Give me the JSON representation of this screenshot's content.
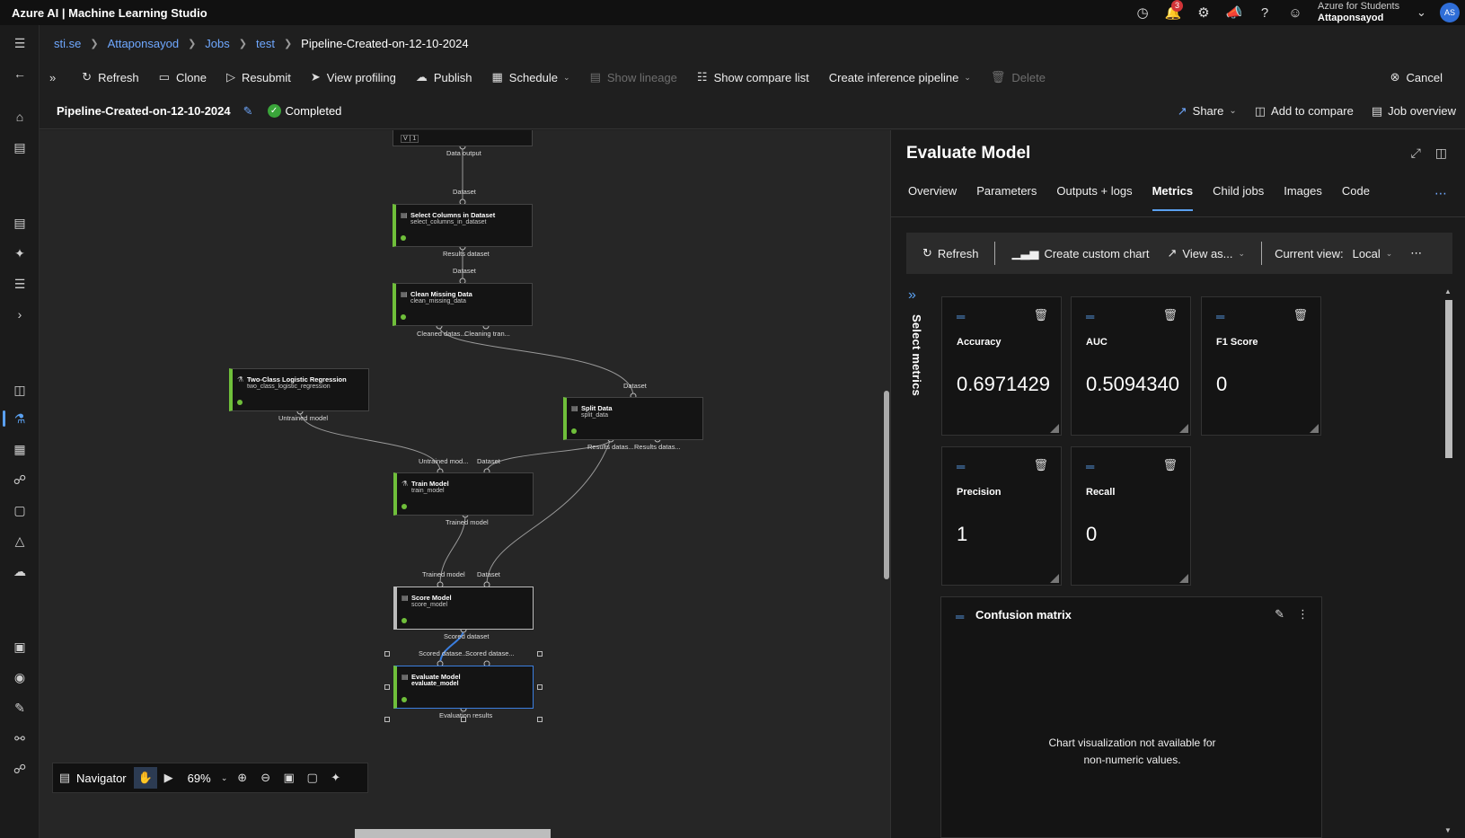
{
  "app": {
    "title": "Azure AI | Machine Learning Studio",
    "notification_count": "3",
    "account_subscription": "Azure for Students",
    "account_name": "Attaponsayod",
    "avatar_initials": "AS"
  },
  "breadcrumb": [
    "sti.se",
    "Attaponsayod",
    "Jobs",
    "test",
    "Pipeline-Created-on-12-10-2024"
  ],
  "toolbar": {
    "refresh": "Refresh",
    "clone": "Clone",
    "resubmit": "Resubmit",
    "view_profiling": "View profiling",
    "publish": "Publish",
    "schedule": "Schedule",
    "show_lineage": "Show lineage",
    "show_compare_list": "Show compare list",
    "create_inference_pipeline": "Create inference pipeline",
    "delete": "Delete",
    "cancel": "Cancel"
  },
  "job": {
    "title": "Pipeline-Created-on-12-10-2024",
    "status": "Completed",
    "share": "Share",
    "add_to_compare": "Add to compare",
    "job_overview": "Job overview"
  },
  "canvas": {
    "nodes": {
      "top_partial": {
        "title": "V | 1"
      },
      "select_columns": {
        "title": "Select Columns in Dataset",
        "sub": "select_columns_in_dataset"
      },
      "clean_missing": {
        "title": "Clean Missing Data",
        "sub": "clean_missing_data"
      },
      "logistic": {
        "title": "Two-Class Logistic Regression",
        "sub": "two_class_logistic_regression"
      },
      "split": {
        "title": "Split Data",
        "sub": "split_data"
      },
      "train": {
        "title": "Train Model",
        "sub": "train_model"
      },
      "score": {
        "title": "Score Model",
        "sub": "score_model"
      },
      "evaluate": {
        "title": "Evaluate Model",
        "sub": "evaluate_model"
      }
    },
    "ports": {
      "data_output": "Data output",
      "dataset": "Dataset",
      "results_dataset": "Results dataset",
      "cleaned_dataset": "Cleaned datas...",
      "cleaning_transform": "Cleaning tran...",
      "untrained_model": "Untrained model",
      "untrained_model_short": "Untrained mod...",
      "results_dataset1": "Results datas...",
      "results_dataset2": "Results datas...",
      "trained_model": "Trained model",
      "scored_dataset": "Scored dataset",
      "scored_dataset_in1": "Scored datase...",
      "scored_dataset_in2": "Scored datase...",
      "evaluation_results": "Evaluation results"
    },
    "navigator": {
      "label": "Navigator",
      "zoom": "69%"
    }
  },
  "panel": {
    "title": "Evaluate Model",
    "tabs": [
      "Overview",
      "Parameters",
      "Outputs + logs",
      "Metrics",
      "Child jobs",
      "Images",
      "Code"
    ],
    "active_tab": "Metrics",
    "cmd": {
      "refresh": "Refresh",
      "create_custom_chart": "Create custom chart",
      "view_as": "View as...",
      "current_view_label": "Current view:",
      "current_view_value": "Local"
    },
    "select_metrics": "Select metrics",
    "metrics": [
      {
        "label": "Accuracy",
        "value": "0.6971429"
      },
      {
        "label": "AUC",
        "value": "0.5094340"
      },
      {
        "label": "F1 Score",
        "value": "0"
      },
      {
        "label": "Precision",
        "value": "1"
      },
      {
        "label": "Recall",
        "value": "0"
      }
    ],
    "confusion": {
      "title": "Confusion matrix",
      "message_line1": "Chart visualization not available for",
      "message_line2": "non-numeric values."
    }
  }
}
